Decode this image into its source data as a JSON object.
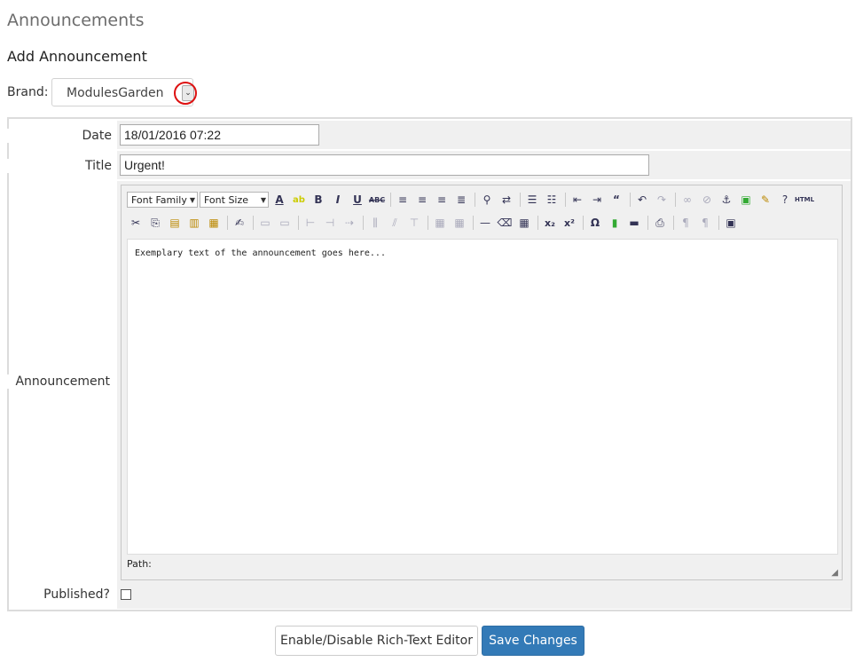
{
  "page": {
    "title": "Announcements",
    "subtitle": "Add Announcement"
  },
  "brand": {
    "label": "Brand:",
    "selected": "ModulesGarden"
  },
  "form": {
    "date_label": "Date",
    "date_value": "18/01/2016 07:22",
    "title_label": "Title",
    "title_value": "Urgent!",
    "announcement_label": "Announcement",
    "published_label": "Published?",
    "published_checked": false
  },
  "editor": {
    "font_family": "Font Family",
    "font_size": "Font Size",
    "content": "Exemplary text of the announcement goes here...",
    "path_label": "Path:",
    "toolbar_row1": [
      "text-color-icon",
      "highlight-icon",
      "bold-icon",
      "italic-icon",
      "underline-icon",
      "strikethrough-icon",
      "align-left-icon",
      "align-center-icon",
      "align-right-icon",
      "justify-icon",
      "find-icon",
      "replace-icon",
      "bullet-list-icon",
      "numbered-list-icon",
      "outdent-icon",
      "indent-icon",
      "blockquote-icon",
      "undo-icon",
      "redo-icon",
      "link-icon",
      "unlink-icon",
      "anchor-icon",
      "image-icon",
      "cleanup-icon",
      "help-icon",
      "html-icon"
    ],
    "toolbar_row2": [
      "cut-icon",
      "copy-icon",
      "paste-icon",
      "paste-text-icon",
      "paste-word-icon",
      "edit-icon",
      "table-row-icon",
      "table-cell-icon",
      "split-icon",
      "merge-icon",
      "insert-col-icon",
      "delete-col-icon",
      "table-props-icon",
      "hr-icon",
      "remove-format-icon",
      "visual-aid-icon",
      "subscript-icon",
      "superscript-icon",
      "special-char-icon",
      "media-icon",
      "line-icon",
      "print-icon",
      "ltr-icon",
      "rtl-icon",
      "fullscreen-icon"
    ]
  },
  "actions": {
    "toggle_editor": "Enable/Disable Rich-Text Editor",
    "save": "Save Changes"
  },
  "colors": {
    "primary": "#337ab7",
    "highlight": "#dd1111"
  }
}
